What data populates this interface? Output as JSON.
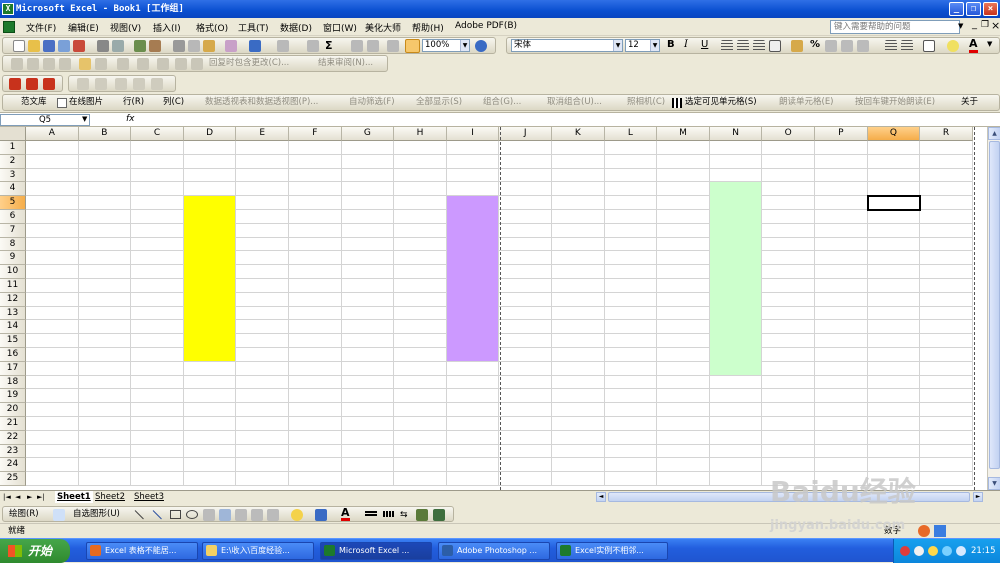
{
  "window": {
    "title": "Microsoft Excel - Book1  [工作组]",
    "app_icon": "excel-icon",
    "minimize": "_",
    "restore": "❐",
    "close": "×"
  },
  "menu": {
    "items": [
      "文件(F)",
      "编辑(E)",
      "视图(V)",
      "插入(I)",
      "格式(O)",
      "工具(T)",
      "数据(D)",
      "窗口(W)",
      "美化大师",
      "帮助(H)",
      "Adobe PDF(B)"
    ],
    "help_placeholder": "键入需要帮助的问题",
    "doc_minimize": "_",
    "doc_restore": "❐",
    "doc_close": "×"
  },
  "standard_toolbar": {
    "zoom": "100%",
    "font_name": "宋体",
    "font_size": "12",
    "bold": "B",
    "italic": "I",
    "underline": "U",
    "percent": "%"
  },
  "review_toolbar": {
    "reply_changes": "回复时包含更改(C)...",
    "end_review": "结束审阅(N)..."
  },
  "custom_toolbar": {
    "items": [
      {
        "label": "范文库",
        "disabled": false
      },
      {
        "label": "在线图片",
        "disabled": false
      },
      {
        "label": "行(R)",
        "disabled": false
      },
      {
        "label": "列(C)",
        "disabled": false
      },
      {
        "label": "数据透视表和数据透视图(P)...",
        "disabled": true
      },
      {
        "label": "自动筛选(F)",
        "disabled": true
      },
      {
        "label": "全部显示(S)",
        "disabled": true
      },
      {
        "label": "组合(G)...",
        "disabled": true
      },
      {
        "label": "取消组合(U)...",
        "disabled": true
      },
      {
        "label": "照相机(C)",
        "disabled": true
      },
      {
        "label": "选定可见单元格(S)",
        "disabled": false
      },
      {
        "label": "朗读单元格(E)",
        "disabled": true
      },
      {
        "label": "按回车键开始朗读(E)",
        "disabled": true
      },
      {
        "label": "关于",
        "disabled": false
      }
    ]
  },
  "formula_bar": {
    "name_box": "Q5",
    "fx": "fx",
    "value": ""
  },
  "grid": {
    "columns": [
      "A",
      "B",
      "C",
      "D",
      "E",
      "F",
      "G",
      "H",
      "I",
      "J",
      "K",
      "L",
      "M",
      "N",
      "O",
      "P",
      "Q",
      "R"
    ],
    "rows": [
      "1",
      "2",
      "3",
      "4",
      "5",
      "6",
      "7",
      "8",
      "9",
      "10",
      "11",
      "12",
      "13",
      "14",
      "15",
      "16",
      "17",
      "18",
      "19",
      "20",
      "21",
      "22",
      "23",
      "24",
      "25"
    ],
    "selected_column": "Q",
    "selected_row": "5",
    "active_cell": "Q5",
    "filled_ranges": [
      {
        "range": "D5:D16",
        "color": "#ffff00"
      },
      {
        "range": "I5:I16",
        "color": "#cc99ff"
      },
      {
        "range": "N4:N17",
        "color": "#ccffcc"
      }
    ]
  },
  "sheet_tabs": {
    "nav": [
      "|◄",
      "◄",
      "►",
      "►|"
    ],
    "tabs": [
      "Sheet1",
      "Sheet2",
      "Sheet3"
    ]
  },
  "drawing_toolbar": {
    "draw": "绘图(R)",
    "autoshapes": "自选图形(U)"
  },
  "status_bar": {
    "left": "就绪",
    "right": "数字"
  },
  "taskbar": {
    "start": "开始",
    "tasks": [
      {
        "label": "Excel 表格不能居...",
        "active": false
      },
      {
        "label": "E:\\收入\\百度经验...",
        "active": false
      },
      {
        "label": "Microsoft Excel ...",
        "active": true
      },
      {
        "label": "Adobe Photoshop ...",
        "active": false
      },
      {
        "label": "Excel实例不相邻...",
        "active": false
      }
    ],
    "clock": "21:15"
  },
  "watermark": {
    "line1": "Baidu经验",
    "line2": "jingyan.baidu.com"
  }
}
